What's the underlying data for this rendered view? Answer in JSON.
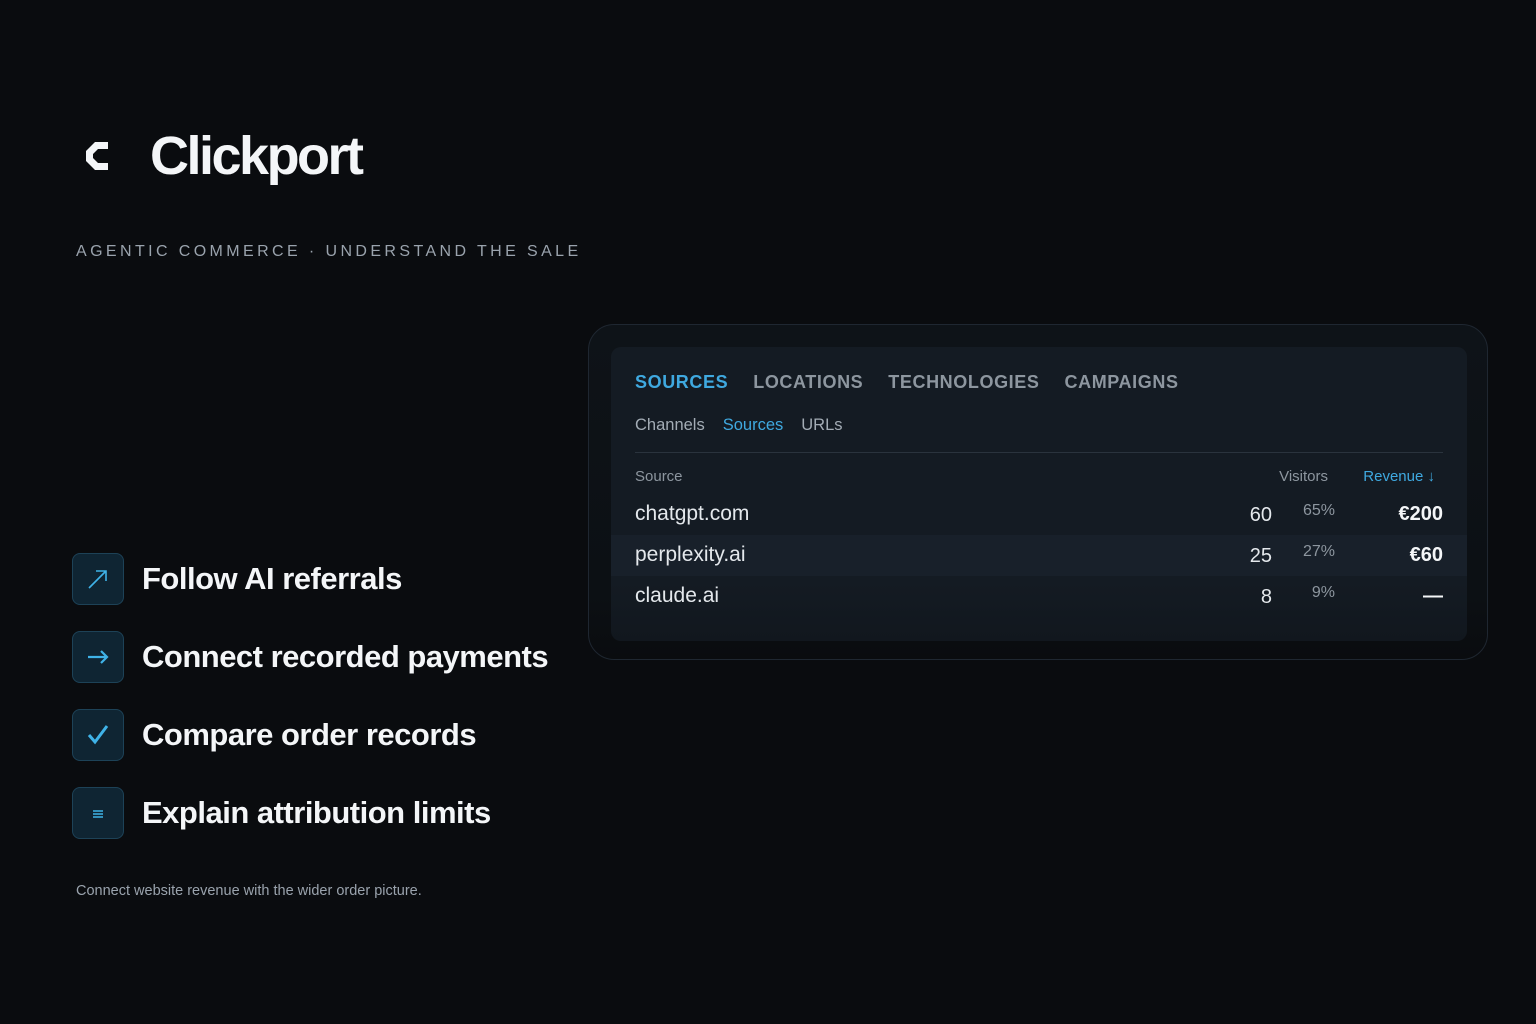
{
  "brand": {
    "name": "Clickport",
    "tagline": "AGENTIC COMMERCE · UNDERSTAND THE SALE"
  },
  "features": [
    {
      "icon": "arrow-up-right-icon",
      "label": "Follow AI referrals"
    },
    {
      "icon": "arrow-right-icon",
      "label": "Connect recorded payments"
    },
    {
      "icon": "check-icon",
      "label": "Compare order records"
    },
    {
      "icon": "list-icon",
      "label": "Explain attribution limits"
    }
  ],
  "footnote": "Connect website revenue with the wider order picture.",
  "panel": {
    "tabs": [
      "SOURCES",
      "LOCATIONS",
      "TECHNOLOGIES",
      "CAMPAIGNS"
    ],
    "active_tab": "SOURCES",
    "subtabs": [
      "Channels",
      "Sources",
      "URLs"
    ],
    "active_subtab": "Sources",
    "columns": {
      "source": "Source",
      "visitors": "Visitors",
      "revenue": "Revenue ↓"
    },
    "rows": [
      {
        "source": "chatgpt.com",
        "visitors": "60",
        "pct": "65%",
        "revenue": "€200"
      },
      {
        "source": "perplexity.ai",
        "visitors": "25",
        "pct": "27%",
        "revenue": "€60"
      },
      {
        "source": "claude.ai",
        "visitors": "8",
        "pct": "9%",
        "revenue": "—"
      }
    ]
  },
  "colors": {
    "accent": "#3fa9e0",
    "background": "#0a0c0f",
    "panel": "#141b23"
  }
}
